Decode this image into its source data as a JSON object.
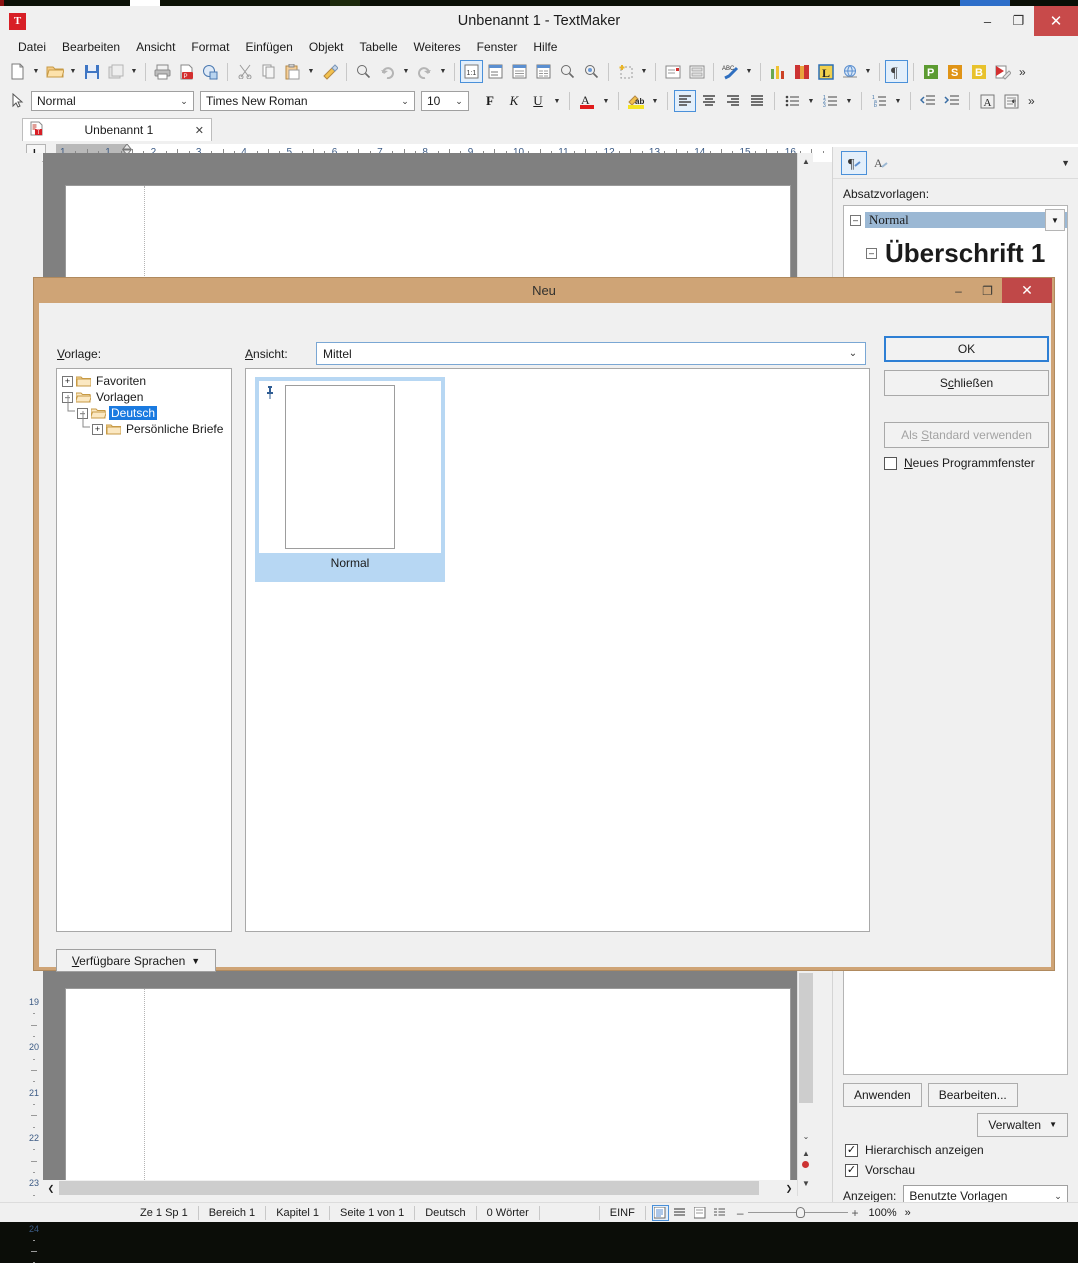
{
  "window": {
    "title": "Unbenannt 1 - TextMaker",
    "app_initial": "T",
    "minimize": "–",
    "maximize": "❐",
    "close": "✕"
  },
  "menubar": {
    "items": [
      "Datei",
      "Bearbeiten",
      "Ansicht",
      "Format",
      "Einfügen",
      "Objekt",
      "Tabelle",
      "Weiteres",
      "Fenster",
      "Hilfe"
    ]
  },
  "toolbar": {
    "overflow": "»"
  },
  "formatbar": {
    "style_value": "Normal",
    "font_value": "Times New Roman",
    "size_value": "10",
    "bold": "F",
    "italic": "K",
    "underline": "U",
    "font_color": "A",
    "highlight": "ab",
    "overflow": "»"
  },
  "doctab": {
    "label": "Unbenannt 1",
    "close": "✕"
  },
  "ruler": {
    "tab_marker": "L",
    "ticks": [
      "1",
      "1",
      "2",
      "3",
      "4",
      "5",
      "6",
      "7",
      "8",
      "9",
      "10",
      "11",
      "12",
      "13",
      "14",
      "15",
      "16"
    ],
    "vertical_ticks": [
      "19",
      "20",
      "21",
      "22",
      "23",
      "24"
    ]
  },
  "sidebar": {
    "tab_paragraph_icon": "pilcrow-icon",
    "tab_character_icon": "character-style-icon",
    "label": "Absatzvorlagen:",
    "styles": [
      {
        "name": "Normal",
        "selected": true
      },
      {
        "name": "Überschrift 1",
        "selected": false
      }
    ],
    "apply_button": "Anwenden",
    "edit_button": "Bearbeiten...",
    "manage_button": "Verwalten",
    "hierarchical_label": "Hierarchisch anzeigen",
    "hierarchical_checked": true,
    "preview_label": "Vorschau",
    "preview_checked": true,
    "show_label": "Anzeigen:",
    "show_value": "Benutzte Vorlagen"
  },
  "dialog": {
    "title": "Neu",
    "minimize": "–",
    "maximize": "❐",
    "close": "✕",
    "template_label": "Vorlage:",
    "view_label": "Ansicht:",
    "view_value": "Mittel",
    "tree": [
      {
        "label": "Favoriten",
        "indent": 0,
        "expander": "+",
        "selected": false
      },
      {
        "label": "Vorlagen",
        "indent": 0,
        "expander": "–",
        "selected": false
      },
      {
        "label": "Deutsch",
        "indent": 1,
        "expander": "–",
        "selected": true
      },
      {
        "label": "Persönliche Briefe",
        "indent": 2,
        "expander": "+",
        "selected": false
      }
    ],
    "templates": [
      {
        "name": "Normal",
        "selected": true,
        "pinned": true
      }
    ],
    "languages_button": "Verfügbare Sprachen",
    "ok_button": "OK",
    "close_button": "Schließen",
    "default_button": "Als Standard verwenden",
    "default_disabled": true,
    "new_window_label": "Neues Programmfenster",
    "new_window_checked": false
  },
  "statusbar": {
    "items": [
      "Ze 1 Sp 1",
      "Bereich 1",
      "Kapitel 1",
      "Seite 1 von 1",
      "Deutsch",
      "0 Wörter"
    ],
    "insert_mode": "EINF",
    "zoom": "100%",
    "overflow": "»"
  },
  "colors": {
    "accent_blue": "#4a90d9",
    "dialog_chrome": "#cfa476",
    "close_red": "#c04848",
    "selection_blue": "#1a7ae0",
    "style_selection": "#9bb8d4"
  }
}
